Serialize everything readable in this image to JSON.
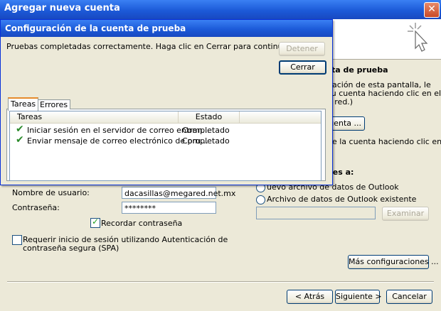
{
  "outer": {
    "title": "Agregar nueva cuenta",
    "close_glyph": "✕",
    "fragments": {
      "section_title": "ta de prueba",
      "desc1": "nación de esta pantalla, le",
      "desc2": "su cuenta haciendo clic en el",
      "desc3": "e red.)",
      "test_button": "cuenta ...",
      "line2": "de la cuenta haciendo clic en",
      "deliver_title": "ies a:",
      "radio1_partial": "uevo archivo de datos de Outlook"
    },
    "labels": {
      "username": "Nombre de usuario:",
      "password": "Contraseña:",
      "remember": "Recordar contraseña",
      "spa_line1": "Requerir inicio de sesión utilizando Autenticación de",
      "spa_line2": "contraseña segura (SPA)",
      "existing_datafile": "Archivo de datos de Outlook existente"
    },
    "fields": {
      "username": "dacasillas@megared.net.mx",
      "password": "********"
    },
    "buttons": {
      "browse": "Examinar",
      "more_settings": "Más configuraciones ...",
      "back": "< Atrás",
      "next": "Siguiente >",
      "cancel": "Cancelar"
    },
    "checks": {
      "remember_checked": "✓"
    }
  },
  "dialog": {
    "title": "Configuración de la cuenta de prueba",
    "message": "Pruebas completadas correctamente. Haga clic en Cerrar para continuar.",
    "stop_button": "Detener",
    "close_button": "Cerrar",
    "tabs": [
      "Tareas",
      "Errores"
    ],
    "columns": [
      "Tareas",
      "Estado"
    ],
    "rows": [
      {
        "task": "Iniciar sesión en el servidor de correo entran...",
        "status": "Completado"
      },
      {
        "task": "Enviar mensaje de correo electrónico de pru...",
        "status": "Completado"
      }
    ],
    "check_glyph": "✔"
  }
}
